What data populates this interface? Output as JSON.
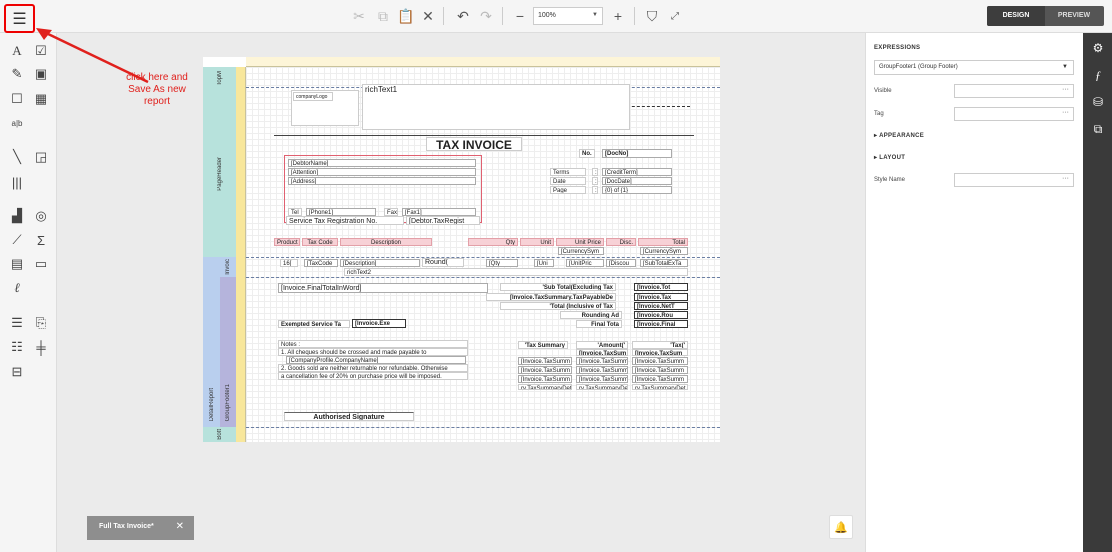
{
  "topbar": {
    "icons": [
      "cut-icon",
      "copy-icon",
      "paste-icon",
      "delete-icon",
      "undo-icon",
      "redo-icon",
      "zoom-out-icon",
      "zoom-in-icon",
      "validate-icon",
      "fullscreen-icon"
    ],
    "zoom_value": "100%",
    "design_label": "DESIGN",
    "preview_label": "PREVIEW"
  },
  "annotation": {
    "text": "click here and Save As new report",
    "color": "#e0201c"
  },
  "report": {
    "bands": {
      "top": "TopM",
      "page_header": "PageHeader",
      "group_header": "Invoic",
      "detail": "DetailReport",
      "group_footer": "GroupFooter1",
      "bottom": "Bott"
    },
    "header": {
      "company_logo": "companyLogo",
      "rich_text": "richText1",
      "title": "TAX INVOICE",
      "no_label": "No.",
      "doc_no": "[DocNo]",
      "debtor_name": "[DebtorName]",
      "attention": "[Attention]",
      "address": "[Address]",
      "terms_label": "Terms",
      "date_label": "Date",
      "page_label": "Page",
      "colon": ":",
      "credit_term": "[CreditTerm]",
      "doc_date": "[DocDate]",
      "page_of": "{0} of {1}",
      "tel_label": "Tel",
      "phone": "[Phone1]",
      "fax_label": "Fax",
      "fax": "[Fax1]",
      "sst_label": "Service Tax Registration No.",
      "sst_value": "[Debtor.TaxRegist"
    },
    "columns": [
      "Product",
      "Tax Code",
      "Description",
      "Qty",
      "Unit",
      "Unit Price",
      "Disc.",
      "Total"
    ],
    "currency_sym1": "[CurrencySym",
    "currency_sym2": "[CurrencySym",
    "detail": {
      "seq": "16[",
      "tax_code": "[TaxCode",
      "description": "[Description]",
      "round": "Round(",
      "qty": "[Qty",
      "unit": "[Uni",
      "unit_price": "[UnitPric",
      "discount": "[Discou",
      "subtotal": "[SubTotalExTa",
      "rich_text2": "richText2"
    },
    "footer": {
      "total_in_word": "[Invoice.FinalTotalInWord]",
      "subtotal_label": "'Sub Total(Excluding Tax",
      "subtotal_value": "[Invoice.Tot",
      "tax_payable_label": "[Invoice.TaxSummary.TaxPayableDe",
      "tax_payable_value": "[Invoice.Tax",
      "total_incl_label": "'Total (Inclusive of Tax",
      "total_incl_value": "[Invoice.NetT",
      "rounding_label": "Rounding Ad",
      "rounding_value": "[Invoice.Rou",
      "final_total_label": "Final Tota",
      "final_total_value": "[Invoice.Final",
      "exempted_label": "Exempted Service Ta",
      "exempted_value": "[Invoice.Exe",
      "notes_title": "Notes :",
      "note1": "1. All cheques should be crossed and made payable to",
      "company_name": "[CompanyProfile.CompanyName]",
      "note2": "2. Goods sold are neither returnable nor refundable. Otherwise",
      "note2b": "a cancellation fee of 20% on purchase price will be imposed.",
      "tax_summary_label": "'Tax Summary",
      "amount_label": "'Amount('",
      "tax_label": "'Tax('",
      "amount_sub": "[Invoice.TaxSum",
      "tax_sub": "[Invoice.TaxSum",
      "tax_rows": [
        "[Invoice.TaxSumm",
        "[Invoice.TaxSumm",
        "[Invoice.TaxSumm",
        "ry.TaxSummaryDet"
      ],
      "signature": "Authorised Signature"
    }
  },
  "properties": {
    "title": "EXPRESSIONS",
    "selected": "GroupFooter1 (Group Footer)",
    "visible_label": "Visible",
    "tag_label": "Tag",
    "appearance_label": "APPEARANCE",
    "layout_label": "LAYOUT",
    "style_name_label": "Style Name",
    "ellipsis": "···"
  },
  "tab": {
    "label": "Full Tax Invoice*",
    "close": "✕"
  }
}
